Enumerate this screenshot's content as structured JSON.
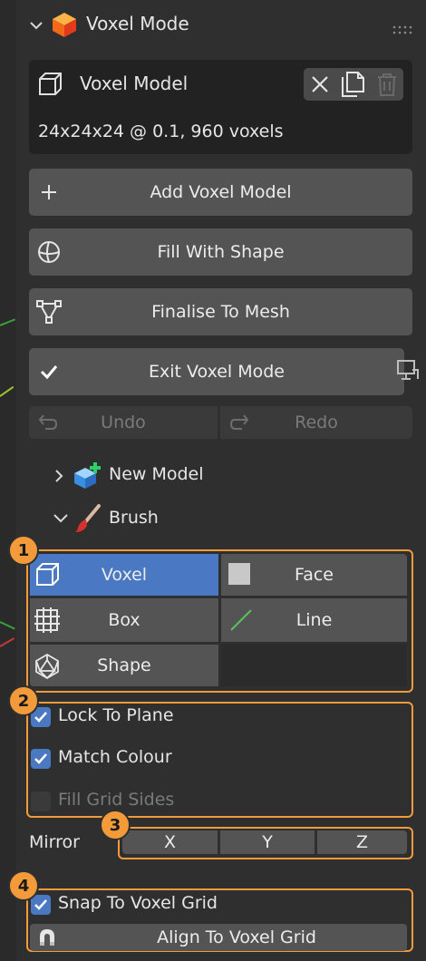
{
  "panel": {
    "title": "Voxel Mode",
    "model_box": {
      "title": "Voxel Model",
      "info": "24x24x24 @ 0.1, 960 voxels"
    },
    "buttons": {
      "add": "Add Voxel Model",
      "fill": "Fill With Shape",
      "finalise": "Finalise To Mesh",
      "exit": "Exit Voxel Mode",
      "undo": "Undo",
      "redo": "Redo"
    },
    "tree": {
      "new_model": "New Model",
      "brush": "Brush"
    },
    "brush_modes": {
      "voxel": "Voxel",
      "face": "Face",
      "box": "Box",
      "line": "Line",
      "shape": "Shape",
      "selected": "Voxel"
    },
    "options": {
      "lock": "Lock To Plane",
      "match": "Match Colour",
      "fill_grid": "Fill Grid Sides"
    },
    "option_states": {
      "lock": true,
      "match": true,
      "fill_grid": false
    },
    "mirror": {
      "label": "Mirror",
      "x": "X",
      "y": "Y",
      "z": "Z"
    },
    "snap": {
      "label": "Snap To Voxel Grid",
      "checked": true
    },
    "align": "Align To Voxel Grid",
    "badges": [
      "1",
      "2",
      "3",
      "4"
    ]
  },
  "colors": {
    "accent": "#4a78c2",
    "annotation": "#f39a3a",
    "panel": "#2f2f2f",
    "button": "#545454"
  }
}
